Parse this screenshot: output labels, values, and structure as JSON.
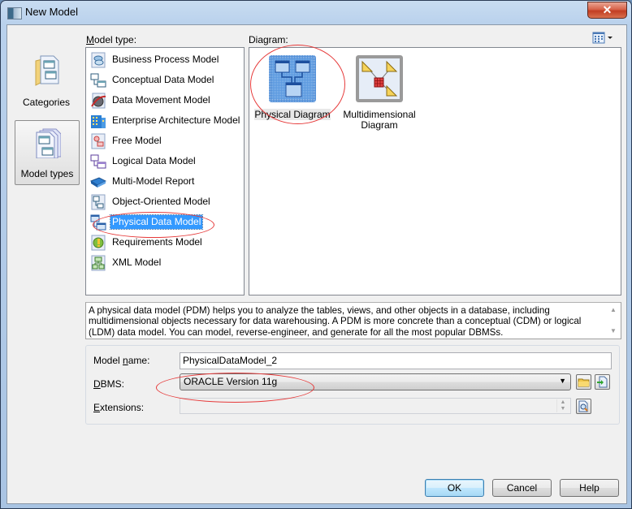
{
  "window": {
    "title": "New Model",
    "close_label": "✕"
  },
  "nav": {
    "items": [
      {
        "label": "Categories",
        "icon": "categories-folder-icon",
        "selected": false
      },
      {
        "label": "Model types",
        "icon": "model-types-icon",
        "selected": true
      }
    ]
  },
  "model_type": {
    "label_prefix": "M",
    "label_rest": "odel type:",
    "items": [
      {
        "label": "Business Process Model",
        "icon": "business-process-model-icon"
      },
      {
        "label": "Conceptual Data Model",
        "icon": "conceptual-data-model-icon"
      },
      {
        "label": "Data Movement Model",
        "icon": "data-movement-model-icon"
      },
      {
        "label": "Enterprise Architecture Model",
        "icon": "enterprise-architecture-model-icon"
      },
      {
        "label": "Free Model",
        "icon": "free-model-icon"
      },
      {
        "label": "Logical Data Model",
        "icon": "logical-data-model-icon"
      },
      {
        "label": "Multi-Model Report",
        "icon": "multi-model-report-icon"
      },
      {
        "label": "Object-Oriented Model",
        "icon": "object-oriented-model-icon"
      },
      {
        "label": "Physical Data Model",
        "icon": "physical-data-model-icon",
        "selected": true
      },
      {
        "label": "Requirements Model",
        "icon": "requirements-model-icon"
      },
      {
        "label": "XML Model",
        "icon": "xml-model-icon"
      }
    ]
  },
  "diagram": {
    "label": "Diagram:",
    "items": [
      {
        "label": "Physical Diagram",
        "icon": "physical-diagram-icon",
        "selected": true
      },
      {
        "label": "Multidimensional Diagram",
        "icon": "multidimensional-diagram-icon",
        "selected": false
      }
    ]
  },
  "description": "A physical data model (PDM) helps you to analyze the tables, views, and other objects in a database, including multidimensional objects necessary for data warehousing. A PDM is more concrete than a conceptual (CDM) or logical (LDM) data model. You can model, reverse-engineer, and generate for all the most popular DBMSs.",
  "form": {
    "model_name_label_a": "Model ",
    "model_name_label_u": "n",
    "model_name_label_b": "ame:",
    "model_name_value": "PhysicalDataModel_2",
    "dbms_label_u": "D",
    "dbms_label_b": "BMS:",
    "dbms_value": "ORACLE Version 11g",
    "extensions_label_u": "E",
    "extensions_label_b": "xtensions:",
    "extensions_value": ""
  },
  "buttons": {
    "ok": "OK",
    "cancel": "Cancel",
    "help": "Help"
  },
  "colors": {
    "selection": "#3399ff",
    "annotation": "#e63a3a"
  }
}
